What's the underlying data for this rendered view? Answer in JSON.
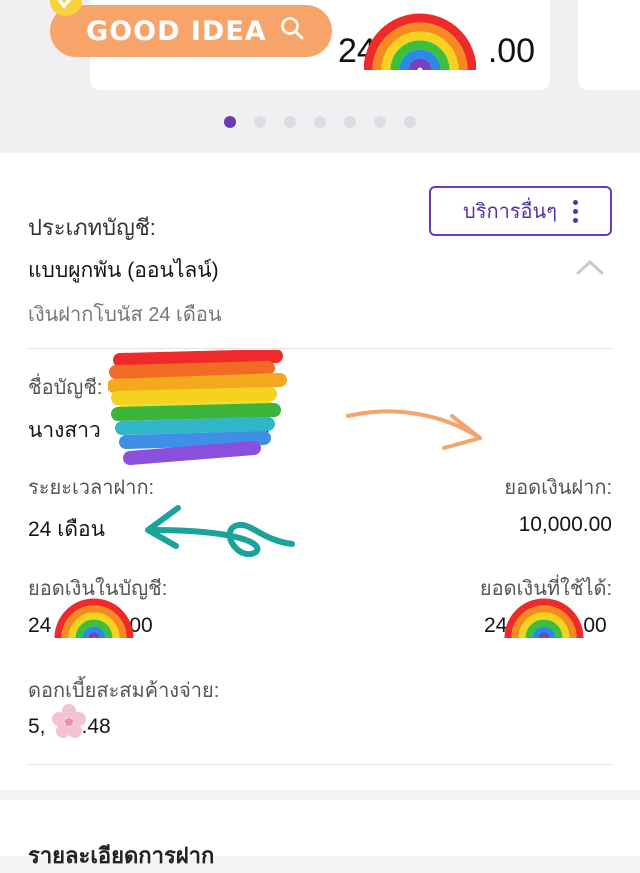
{
  "banner": {
    "pill_label": "GOOD IDEA",
    "amount_start": "24",
    "amount_end": ".00"
  },
  "carousel": {
    "count": 7,
    "active": 0
  },
  "account": {
    "type_label": "ประเภทบัญชี:",
    "type_value": "แบบผูกพัน (ออนไลน์)",
    "type_sub": "เงินฝากโบนัส 24 เดือน",
    "service_button": "บริการอื่นๆ",
    "name_label": "ชื่อบัญชี:",
    "name_value": "นางสาว",
    "name_end": "ว",
    "term_label": "ระยะเวลาฝาก:",
    "term_value": "24 เดือน",
    "deposit_label": "ยอดเงินฝาก:",
    "deposit_value": "10,000.00",
    "balance_label": "ยอดเงินในบัญชี:",
    "balance_start": "24",
    "balance_end": "00",
    "available_label": "ยอดเงินที่ใช้ได้:",
    "available_start": "24",
    "available_end": "00",
    "interest_label": "ดอกเบี้ยสะสมค้างจ่าย:",
    "interest_start": "5,",
    "interest_end": ".48"
  },
  "details": {
    "title": "รายละเอียดการฝาก"
  },
  "colors": {
    "accent": "#6a3bb8",
    "pill": "#f7a46a",
    "arrow_orange": "#f2a46a",
    "arrow_teal": "#1aa39a"
  },
  "icons": [
    "search-icon",
    "kebab-menu-icon",
    "chevron-up-icon",
    "checkmark-icon"
  ]
}
